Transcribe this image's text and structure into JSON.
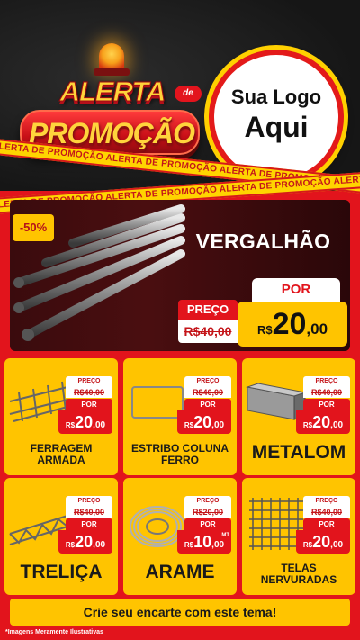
{
  "header": {
    "alerta": "ALERTA",
    "de": "de",
    "promocao": "PROMOÇÃO",
    "logo_line1": "Sua Logo",
    "logo_line2": "Aqui",
    "tape_text": "ALERTA DE PROMOÇÃO   ALERTA DE PROMOÇÃO   ALERTA DE PROMOÇÃO   ALERTA DE PROMOÇÃO"
  },
  "featured": {
    "discount": "-50%",
    "title": "VERGALHÃO",
    "por_label": "POR",
    "preco_label": "PREÇO",
    "old_price": "R$40,00",
    "new_currency": "R$",
    "new_int": "20",
    "new_dec": ",00"
  },
  "products": [
    {
      "name": "FERRAGEM ARMADA",
      "preco_label": "PREÇO",
      "old_price": "R$40,00",
      "por_label": "POR",
      "currency": "R$",
      "int": "20",
      "dec": ",00",
      "unit": "",
      "icon": "reinforced-cage-icon"
    },
    {
      "name": "ESTRIBO COLUNA FERRO",
      "preco_label": "PREÇO",
      "old_price": "R$40,00",
      "por_label": "POR",
      "currency": "R$",
      "int": "20",
      "dec": ",00",
      "unit": "",
      "icon": "stirrup-icon"
    },
    {
      "name": "METALOM",
      "preco_label": "PREÇO",
      "old_price": "R$40,00",
      "por_label": "POR",
      "currency": "R$",
      "int": "20",
      "dec": ",00",
      "unit": "",
      "icon": "metal-tube-icon"
    },
    {
      "name": "TRELIÇA",
      "preco_label": "PREÇO",
      "old_price": "R$40,00",
      "por_label": "POR",
      "currency": "R$",
      "int": "20",
      "dec": ",00",
      "unit": "",
      "icon": "truss-icon"
    },
    {
      "name": "ARAME",
      "preco_label": "PREÇO",
      "old_price": "R$20,00",
      "por_label": "POR",
      "currency": "R$",
      "int": "10",
      "dec": ",00",
      "unit": "MT",
      "icon": "wire-coil-icon"
    },
    {
      "name": "TELAS NERVURADAS",
      "preco_label": "PREÇO",
      "old_price": "R$40,00",
      "por_label": "POR",
      "currency": "R$",
      "int": "20",
      "dec": ",00",
      "unit": "",
      "icon": "wire-mesh-icon"
    }
  ],
  "footer": {
    "cta": "Crie seu encarte com este tema!",
    "disclaimer": "*Imagens Meramente Ilustrativas"
  },
  "colors": {
    "red": "#e2141c",
    "yellow": "#ffc400",
    "dark": "#1a1a1a"
  }
}
